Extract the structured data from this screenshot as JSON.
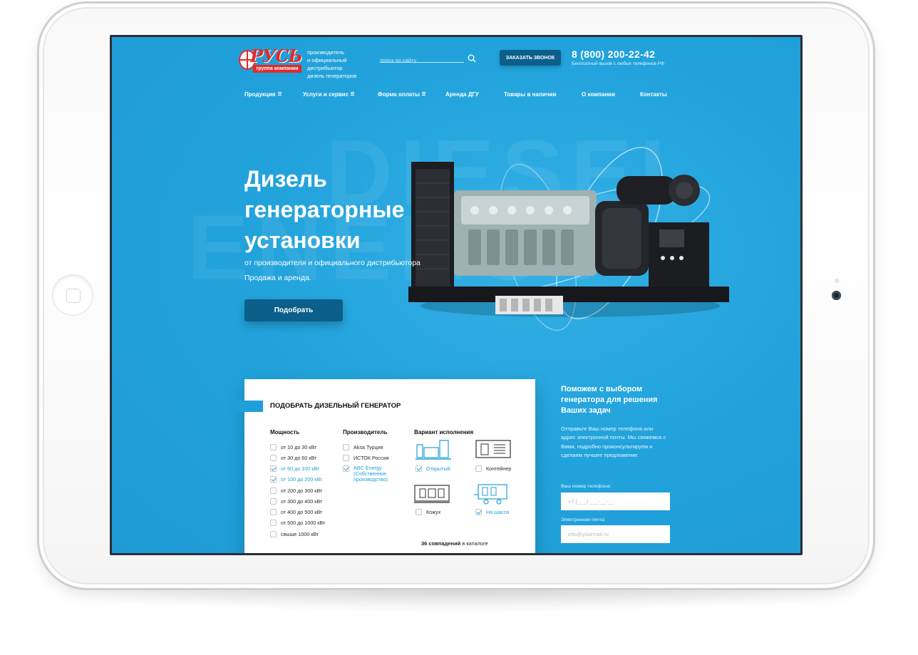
{
  "brand": {
    "logo_text": "РУСЬ",
    "logo_sub": "группа компании",
    "tagline": [
      "производитель",
      "и официальный",
      "дистрибьютор",
      "дизель генераторов"
    ]
  },
  "search": {
    "placeholder": "поиск по сайту"
  },
  "header": {
    "callback_label": "ЗАКАЗАТЬ ЗВОНОК",
    "phone": "8 (800) 200-22-42",
    "phone_note": "Бесплатный вызов с любых телефонов РФ"
  },
  "nav": {
    "items": [
      {
        "label": "Продукция",
        "has_menu": true
      },
      {
        "label": "Услуги и сервис",
        "has_menu": true
      },
      {
        "label": "Форма оплаты",
        "has_menu": true
      },
      {
        "label": "Аренда ДГУ",
        "has_menu": false
      },
      {
        "label": "Товары в наличии",
        "has_menu": false
      },
      {
        "label": "О компании",
        "has_menu": false
      },
      {
        "label": "Контакты",
        "has_menu": false
      }
    ]
  },
  "hero": {
    "watermark_1": "DIESEL",
    "watermark_2": "ENERGY",
    "title_lines": [
      "Дизель",
      "генераторные",
      "установки"
    ],
    "subtitle": "от производителя и официального дистрибьютора",
    "subtitle2": "Продажа и аренда.",
    "button_label": "Подобрать"
  },
  "filter": {
    "title": "ПОДОБРАТЬ ДИЗЕЛЬНЫЙ ГЕНЕРАТОР",
    "power": {
      "label": "Мощность",
      "options": [
        {
          "label": "от 10 до 30 кВт",
          "checked": false
        },
        {
          "label": "от 30 до 60 кВт",
          "checked": false
        },
        {
          "label": "от 60 до 100 кВт",
          "checked": true
        },
        {
          "label": "от 100 до 200 кВт",
          "checked": true
        },
        {
          "label": "от 200 до 300 кВт",
          "checked": false
        },
        {
          "label": "от 300 до 400 кВт",
          "checked": false
        },
        {
          "label": "от 400 до 500 кВт",
          "checked": false
        },
        {
          "label": "от 500 до 1000 кВт",
          "checked": false
        },
        {
          "label": "свыше 1000 кВт",
          "checked": false
        }
      ]
    },
    "manufacturer": {
      "label": "Производитель",
      "options": [
        {
          "label": "Aksa Турция",
          "checked": false
        },
        {
          "label": "ИСТОК Россия",
          "checked": false
        },
        {
          "label": "ABC Energy (Собственное производство)",
          "checked": true
        }
      ]
    },
    "variant": {
      "label": "Вариант исполнения",
      "options": [
        {
          "label": "Открытый",
          "checked": true,
          "icon": "open-generator-icon"
        },
        {
          "label": "Контейнер",
          "checked": false,
          "icon": "container-icon"
        },
        {
          "label": "Кожух",
          "checked": false,
          "icon": "casing-icon"
        },
        {
          "label": "На шасси",
          "checked": true,
          "icon": "trailer-icon"
        }
      ]
    },
    "matches_count": "36 совпадений",
    "matches_suffix": "в каталоге"
  },
  "help": {
    "title": "Поможем с выбором генератора для решения Ваших задач",
    "text": "Отправьте Ваш номер телефона или адрес электронной почты. Мы свяжемся с Вами, подробно проконсультируем и сделаем лучшее предложение.",
    "phone_label": "Ваш номер телефона:",
    "phone_placeholder": "+7 (___) ___-__-__",
    "email_label": "Электронная почта:",
    "email_placeholder": "info@yourmail.ru"
  },
  "colors": {
    "background": "#1f9fd9",
    "button_dark": "#0b5f8a",
    "logo_red": "#e22a2a",
    "check_accent": "#1f9fd9"
  }
}
